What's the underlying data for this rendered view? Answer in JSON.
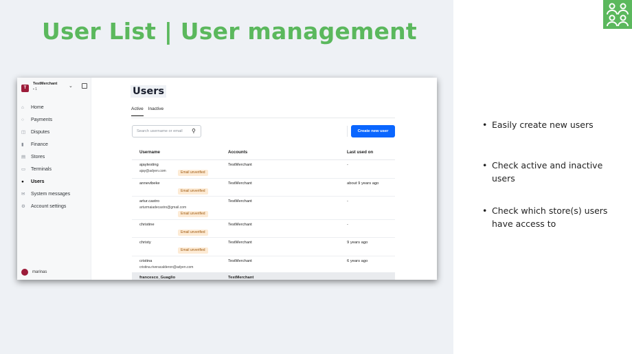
{
  "slide": {
    "title": "User List | User management",
    "bullets": [
      "Easily create new users",
      "Check active and inactive users",
      "Check which store(s) users have access to"
    ]
  },
  "colors": {
    "accent": "#5bb85d",
    "primary_button": "#0a66ff",
    "badge_bg": "#fdebd5",
    "avatar": "#9c1c3a"
  },
  "logo": {
    "icon": "users-group-icon"
  },
  "app": {
    "merchant": {
      "initial": "T",
      "name": "TestMerchant",
      "count": "1"
    },
    "nav": [
      {
        "icon": "home-icon",
        "label": "Home"
      },
      {
        "icon": "payments-icon",
        "label": "Payments"
      },
      {
        "icon": "disputes-icon",
        "label": "Disputes"
      },
      {
        "icon": "finance-icon",
        "label": "Finance"
      },
      {
        "icon": "stores-icon",
        "label": "Stores"
      },
      {
        "icon": "terminals-icon",
        "label": "Terminals"
      },
      {
        "icon": "users-icon",
        "label": "Users",
        "active": true
      },
      {
        "icon": "messages-icon",
        "label": "System messages"
      },
      {
        "icon": "settings-icon",
        "label": "Account settings"
      }
    ],
    "current_user": "marinas",
    "page_title": "Users",
    "tabs": [
      {
        "label": "Active",
        "active": true
      },
      {
        "label": "Inactive"
      }
    ],
    "search_placeholder": "Search username or email",
    "create_button": "Create new user",
    "columns": [
      "Username",
      "Accounts",
      "Last used on"
    ],
    "rows": [
      {
        "username": "ajaytesting",
        "email": "ajay@adyen.com",
        "badge": "Email unverified",
        "account": "TestMerchant",
        "last_used": "-"
      },
      {
        "username": "annevibeke",
        "email": "",
        "badge": "Email unverified",
        "account": "TestMerchant",
        "last_used": "about 9 years ago"
      },
      {
        "username": "artur.castro",
        "email": "arturmaiadecastro@gmail.com",
        "badge": "Email unverified",
        "account": "TestMerchant",
        "last_used": "-"
      },
      {
        "username": "christine",
        "email": "",
        "badge": "Email unverified",
        "account": "TestMerchant",
        "last_used": "-"
      },
      {
        "username": "christy",
        "email": "",
        "badge": "Email unverified",
        "account": "TestMerchant",
        "last_used": "9 years ago"
      },
      {
        "username": "cristina",
        "email": "cristina.riveracalderon@adyen.com",
        "badge": "",
        "account": "TestMerchant",
        "last_used": "6 years ago"
      },
      {
        "username": "francesco_Guaglio",
        "email": "",
        "badge": "",
        "account": "TestMerchant",
        "last_used": ""
      }
    ]
  }
}
